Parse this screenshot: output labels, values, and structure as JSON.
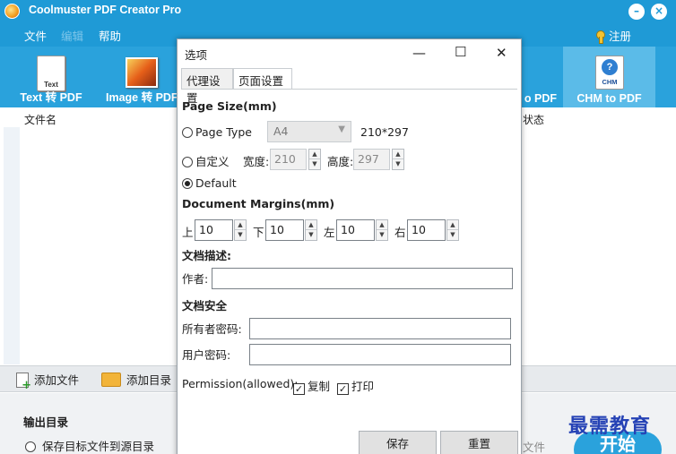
{
  "app": {
    "title": "Coolmuster PDF Creator Pro"
  },
  "window_controls": {
    "minimize": "–",
    "close": "×"
  },
  "menu": {
    "file": "文件",
    "edit": "编辑",
    "help": "帮助",
    "register": "注册"
  },
  "toolbar": {
    "text_to_pdf": "Text 转 PDF",
    "text_icon_caption": "Text",
    "image_to_pdf": "Image 转 PDF",
    "partial_label": "o PDF",
    "chm_to_pdf": "CHM to PDF",
    "chm_icon_caption": "CHM"
  },
  "file_list": {
    "col_filename": "文件名",
    "col_status": "状态"
  },
  "bottom_bar": {
    "add_file": "添加文件",
    "add_folder": "添加目录"
  },
  "output": {
    "title": "输出目录",
    "option_source": "保存目标文件到源目录",
    "file_partial": "文件"
  },
  "start_button": "开始",
  "watermark": "最需教育",
  "dialog": {
    "title": "选项",
    "controls": {
      "minimize": "—",
      "maximize": "☐",
      "close": "✕"
    },
    "tabs": [
      "代理设置",
      "页面设置"
    ],
    "page_size": {
      "heading": "Page Size(mm)",
      "page_type_label": "Page Type",
      "page_type_value": "A4",
      "page_type_dims": "210*297",
      "custom_label": "自定义",
      "width_label": "宽度:",
      "width_value": "210",
      "height_label": "高度:",
      "height_value": "297",
      "default_label": "Default"
    },
    "margins": {
      "heading": "Document Margins(mm)",
      "top_label": "上:",
      "top_value": "10",
      "bottom_label": "下:",
      "bottom_value": "10",
      "left_label": "左:",
      "left_value": "10",
      "right_label": "右:",
      "right_value": "10"
    },
    "description": {
      "heading": "文档描述:",
      "author_label": "作者:",
      "author_value": ""
    },
    "security": {
      "heading": "文档安全",
      "owner_pwd_label": "所有者密码:",
      "owner_pwd_value": "",
      "user_pwd_label": "用户密码:",
      "user_pwd_value": "",
      "permission_label": "Permission(allowed):",
      "copy_label": "复制",
      "print_label": "打印"
    },
    "buttons": {
      "save": "保存",
      "reset": "重置"
    }
  }
}
